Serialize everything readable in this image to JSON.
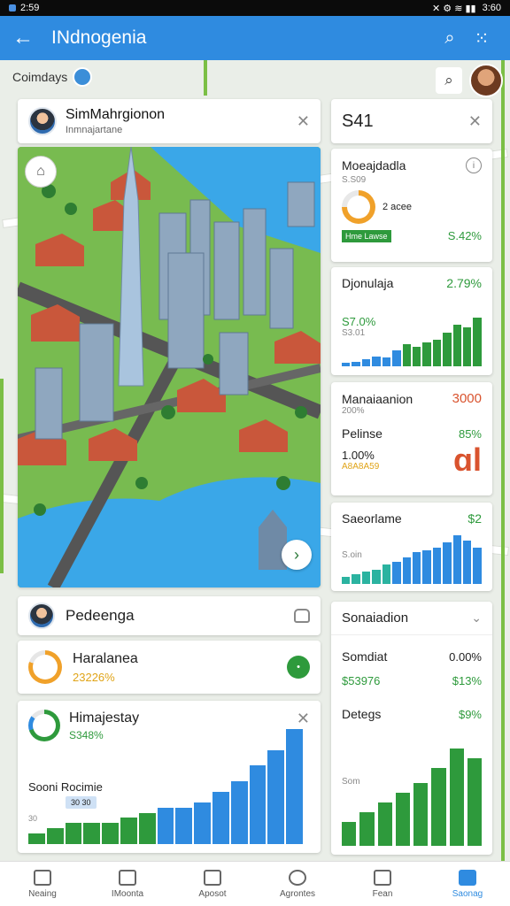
{
  "status": {
    "left": "2:59",
    "right": "3:60"
  },
  "appbar": {
    "title": "INdnogenia"
  },
  "location": {
    "label": "Coimdays"
  },
  "profile": {
    "name": "SimMahrgionon",
    "subtitle": "Inmnajartane"
  },
  "cards": {
    "predenga": {
      "title": "Pedeenga"
    },
    "haralanea": {
      "title": "Haralanea",
      "value": "23226%"
    },
    "himaejestay": {
      "title": "Himajestay",
      "value": "S348%",
      "chart_label": "Sooni Rocimie",
      "chart_tag": "30 30"
    }
  },
  "right": {
    "header": {
      "value": "S41"
    },
    "metric1": {
      "title": "Moeajdadla",
      "sub": "S.S09",
      "ring_label": "2 acee",
      "tag": "Hme Lawse",
      "value": "S.42%"
    },
    "metric2": {
      "title": "Djonulaja",
      "value": "2.79%",
      "sub": "S7.0%",
      "sub2": "S3.01"
    },
    "metric3": {
      "title": "Manaiaanion",
      "value": "3000",
      "sub": "200%",
      "title2": "Pelinse",
      "value2": "85%",
      "sub2": "1.00%",
      "stars": "A8A8A59"
    },
    "metric4": {
      "title": "Saeorlame",
      "value": "$2",
      "sub": "S.oin"
    },
    "metric5": {
      "title": "Sonaiadion",
      "row1_label": "Somdiat",
      "row1_value": "0.00%",
      "row2_label": "$53976",
      "row2_value": "$13%",
      "row3_label": "Detegs",
      "row3_value": "$9%",
      "axis": "Som"
    }
  },
  "chart_data": [
    {
      "type": "bar",
      "id": "djonulaja",
      "values": [
        3,
        4,
        6,
        8,
        7,
        13,
        18,
        16,
        20,
        22,
        28,
        34,
        32,
        40
      ]
    },
    {
      "type": "bar",
      "id": "saeorlame",
      "values": [
        6,
        8,
        10,
        12,
        16,
        18,
        22,
        26,
        28,
        30,
        34,
        40,
        36,
        30
      ]
    },
    {
      "type": "bar",
      "id": "himajestay",
      "values": [
        4,
        6,
        8,
        8,
        8,
        10,
        12,
        14,
        14,
        16,
        20,
        24,
        30,
        36,
        44
      ]
    },
    {
      "type": "bar",
      "id": "sonaiadion",
      "values": [
        10,
        14,
        18,
        22,
        26,
        32,
        40,
        36
      ]
    }
  ],
  "nav": [
    "Neaing",
    "IMoonta",
    "Aposot",
    "Agrontes",
    "Fean",
    "Saonag"
  ],
  "colors": {
    "accent": "#2f8be0",
    "green": "#2e9a3c",
    "red": "#d9532e"
  }
}
